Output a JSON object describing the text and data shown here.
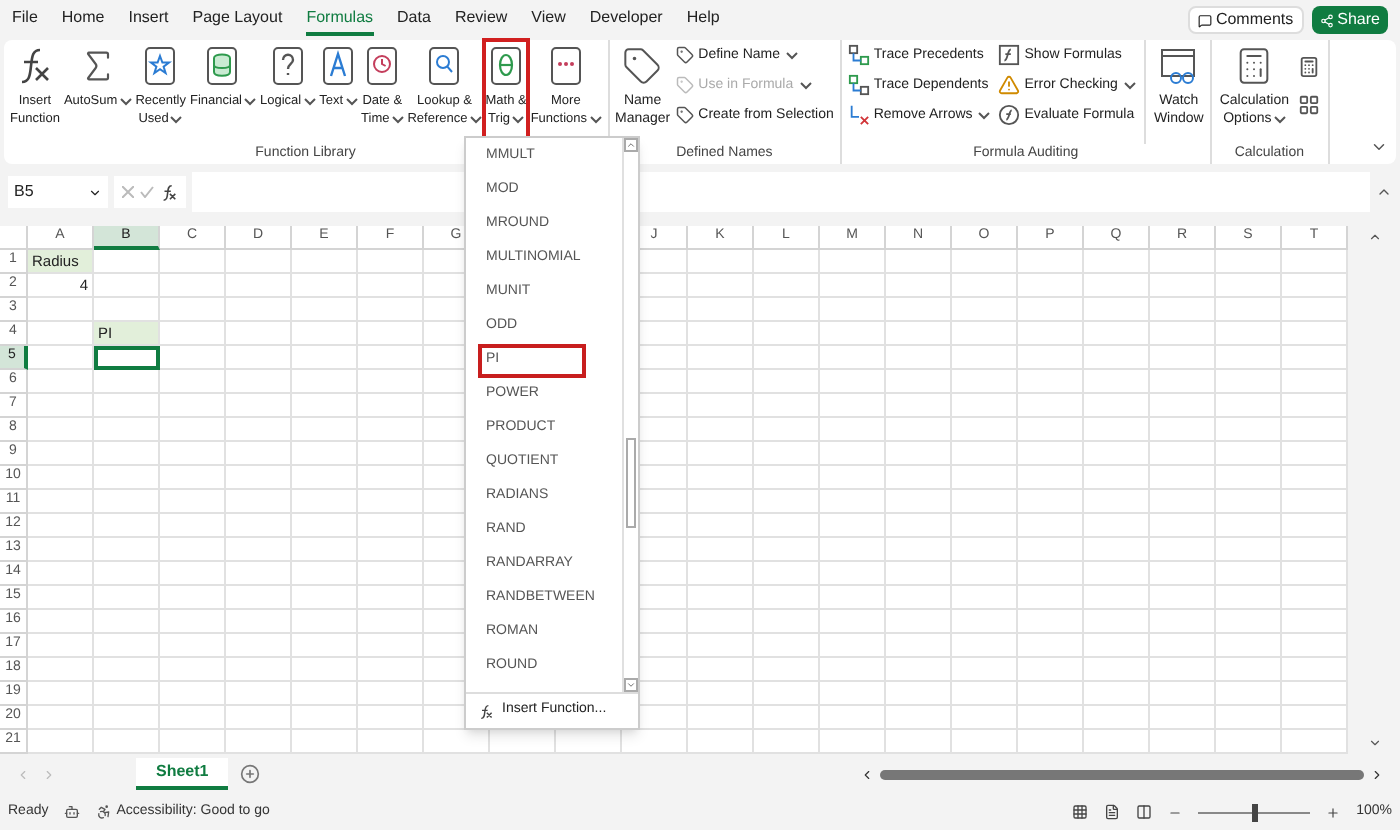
{
  "menu_tabs": [
    {
      "label": "File",
      "selected": false
    },
    {
      "label": "Home",
      "selected": false
    },
    {
      "label": "Insert",
      "selected": false
    },
    {
      "label": "Page Layout",
      "selected": false
    },
    {
      "label": "Formulas",
      "selected": true
    },
    {
      "label": "Data",
      "selected": false
    },
    {
      "label": "Review",
      "selected": false
    },
    {
      "label": "View",
      "selected": false
    },
    {
      "label": "Developer",
      "selected": false
    },
    {
      "label": "Help",
      "selected": false
    }
  ],
  "comments_button": "Comments",
  "share_button": "Share",
  "function_library": {
    "title": "Function Library",
    "buttons": [
      {
        "kind": "insert",
        "lines": [
          "Insert",
          "Function"
        ],
        "menu": false,
        "highlighted": false
      },
      {
        "kind": "sum",
        "lines": [
          "AutoSum"
        ],
        "menu": true,
        "highlighted": false
      },
      {
        "kind": "star",
        "lines": [
          "Recently",
          "Used"
        ],
        "menu": true,
        "highlighted": false
      },
      {
        "kind": "coins",
        "lines": [
          "Financial"
        ],
        "menu": true,
        "highlighted": false
      },
      {
        "kind": "question",
        "lines": [
          "Logical"
        ],
        "menu": true,
        "highlighted": false
      },
      {
        "kind": "letter",
        "lines": [
          "Text"
        ],
        "menu": true,
        "highlighted": false
      },
      {
        "kind": "clock",
        "lines": [
          "Date &",
          "Time"
        ],
        "menu": true,
        "highlighted": false
      },
      {
        "kind": "search",
        "lines": [
          "Lookup &",
          "Reference"
        ],
        "menu": true,
        "highlighted": false
      },
      {
        "kind": "theta",
        "lines": [
          "Math &",
          "Trig"
        ],
        "menu": true,
        "highlighted": true
      },
      {
        "kind": "more",
        "lines": [
          "More",
          "Functions"
        ],
        "menu": true,
        "highlighted": false
      }
    ]
  },
  "defined_names": {
    "title": "Defined Names",
    "manager": [
      "Name",
      "Manager"
    ],
    "items": [
      {
        "label": "Define Name",
        "menu": true,
        "disabled": false
      },
      {
        "label": "Use in Formula",
        "menu": true,
        "disabled": true
      },
      {
        "label": "Create from Selection",
        "menu": false,
        "disabled": false
      }
    ]
  },
  "formula_auditing": {
    "title": "Formula Auditing",
    "items": [
      {
        "kind": "precedents",
        "label": "Trace Precedents",
        "menu": false
      },
      {
        "kind": "show",
        "label": "Show Formulas",
        "menu": false
      },
      {
        "kind": "dependents",
        "label": "Trace Dependents",
        "menu": false
      },
      {
        "kind": "error",
        "label": "Error Checking",
        "menu": true
      },
      {
        "kind": "remove",
        "label": "Remove Arrows",
        "menu": true
      },
      {
        "kind": "evaluate",
        "label": "Evaluate Formula",
        "menu": false
      }
    ],
    "watch": [
      "Watch",
      "Window"
    ]
  },
  "calculation": {
    "title": "Calculation",
    "options": [
      "Calculation",
      "Options"
    ]
  },
  "name_box": "B5",
  "grid": {
    "columns_left": [
      {
        "label": "A",
        "selected": false
      },
      {
        "label": "B",
        "selected": true
      },
      {
        "label": "C",
        "selected": false
      },
      {
        "label": "D",
        "selected": false
      },
      {
        "label": "E",
        "selected": false
      },
      {
        "label": "F",
        "selected": false
      },
      {
        "label": "G",
        "selected": false
      }
    ],
    "columns_right": [
      {
        "label": "J",
        "selected": false
      },
      {
        "label": "K",
        "selected": false
      },
      {
        "label": "L",
        "selected": false
      },
      {
        "label": "M",
        "selected": false
      },
      {
        "label": "N",
        "selected": false
      },
      {
        "label": "O",
        "selected": false
      },
      {
        "label": "P",
        "selected": false
      },
      {
        "label": "Q",
        "selected": false
      },
      {
        "label": "R",
        "selected": false
      },
      {
        "label": "S",
        "selected": false
      },
      {
        "label": "T",
        "selected": false
      }
    ],
    "rows": [
      {
        "label": "1",
        "selected": false,
        "cells": [
          {
            "kind": "text",
            "text": "Radius",
            "shaded": true
          }
        ]
      },
      {
        "label": "2",
        "selected": false,
        "cells": [
          {
            "kind": "number",
            "text": "4",
            "shaded": false
          }
        ]
      },
      {
        "label": "3",
        "selected": false
      },
      {
        "label": "4",
        "selected": false,
        "cells": [
          {
            "kind": "blank"
          },
          {
            "kind": "text",
            "text": "PI",
            "shaded": true
          }
        ]
      },
      {
        "label": "5",
        "selected": true
      },
      {
        "label": "6",
        "selected": false
      },
      {
        "label": "7",
        "selected": false
      },
      {
        "label": "8",
        "selected": false
      },
      {
        "label": "9",
        "selected": false
      },
      {
        "label": "10",
        "selected": false
      },
      {
        "label": "11",
        "selected": false
      },
      {
        "label": "12",
        "selected": false
      },
      {
        "label": "13",
        "selected": false
      },
      {
        "label": "14",
        "selected": false
      },
      {
        "label": "15",
        "selected": false
      },
      {
        "label": "16",
        "selected": false
      },
      {
        "label": "17",
        "selected": false
      },
      {
        "label": "18",
        "selected": false
      },
      {
        "label": "19",
        "selected": false
      },
      {
        "label": "20",
        "selected": false
      },
      {
        "label": "21",
        "selected": false
      }
    ]
  },
  "math_menu": {
    "items": [
      {
        "label": "MMULT",
        "selected": false
      },
      {
        "label": "MOD",
        "selected": false
      },
      {
        "label": "MROUND",
        "selected": false
      },
      {
        "label": "MULTINOMIAL",
        "selected": false
      },
      {
        "label": "MUNIT",
        "selected": false
      },
      {
        "label": "ODD",
        "selected": false
      },
      {
        "label": "PI",
        "selected": true
      },
      {
        "label": "POWER",
        "selected": false
      },
      {
        "label": "PRODUCT",
        "selected": false
      },
      {
        "label": "QUOTIENT",
        "selected": false
      },
      {
        "label": "RADIANS",
        "selected": false
      },
      {
        "label": "RAND",
        "selected": false
      },
      {
        "label": "RANDARRAY",
        "selected": false
      },
      {
        "label": "RANDBETWEEN",
        "selected": false
      },
      {
        "label": "ROMAN",
        "selected": false
      },
      {
        "label": "ROUND",
        "selected": false
      }
    ],
    "footer": "Insert Function..."
  },
  "sheet_tabs": [
    {
      "label": "Sheet1",
      "selected": true
    }
  ],
  "status_bar": {
    "ready": "Ready",
    "accessibility": "Accessibility: Good to go",
    "zoom": "100%",
    "zoom_slider": {
      "level": 0.5
    }
  }
}
